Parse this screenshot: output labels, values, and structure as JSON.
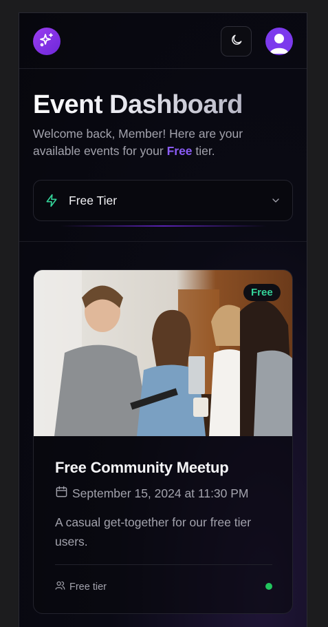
{
  "header": {
    "logo_icon": "sparkles-icon",
    "theme_toggle_icon": "moon-icon",
    "avatar_icon": "user-avatar-icon"
  },
  "page": {
    "title": "Event Dashboard",
    "welcome_prefix": "Welcome back, Member! Here are your available events for your ",
    "welcome_tier": "Free",
    "welcome_suffix": " tier."
  },
  "tier_select": {
    "icon": "lightning-bolt-icon",
    "selected": "Free Tier",
    "chevron_icon": "chevron-down-icon"
  },
  "events": [
    {
      "badge": "Free",
      "title": "Free Community Meetup",
      "date": "September 15, 2024 at 11:30 PM",
      "description": "A casual get-together for our free tier users.",
      "tier_label": "Free tier",
      "status_color": "#22c55e"
    }
  ],
  "colors": {
    "accent": "#8b5cf6",
    "badge_text": "#34d399",
    "status": "#22c55e"
  }
}
